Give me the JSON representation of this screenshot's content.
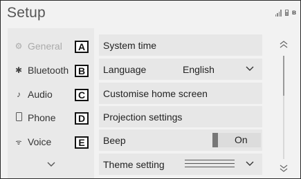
{
  "header": {
    "title": "Setup"
  },
  "status": {
    "signal_icon": "signal-bars-icon",
    "battery_icon": "battery-icon",
    "bluetooth_icon": "bluetooth-icon"
  },
  "sidebar": {
    "items": [
      {
        "label": "General",
        "icon": "gear-icon",
        "letter": "A",
        "selected": true
      },
      {
        "label": "Bluetooth",
        "icon": "bluetooth-icon",
        "letter": "B",
        "selected": false
      },
      {
        "label": "Audio",
        "icon": "music-note-icon",
        "letter": "C",
        "selected": false
      },
      {
        "label": "Phone",
        "icon": "phone-icon",
        "letter": "D",
        "selected": false
      },
      {
        "label": "Voice",
        "icon": "voice-icon",
        "letter": "E",
        "selected": false
      }
    ],
    "more_icon": "chevron-down-icon"
  },
  "settings": {
    "rows": [
      {
        "label": "System time"
      },
      {
        "label": "Language",
        "value": "English"
      },
      {
        "label": "Customise home screen"
      },
      {
        "label": "Projection settings"
      },
      {
        "label": "Beep",
        "toggle_value": "On"
      },
      {
        "label": "Theme setting"
      }
    ]
  },
  "colors": {
    "background": "#f2f2f2",
    "panel": "#e7e7e7",
    "text": "#222222",
    "muted": "#aaaaaa"
  }
}
